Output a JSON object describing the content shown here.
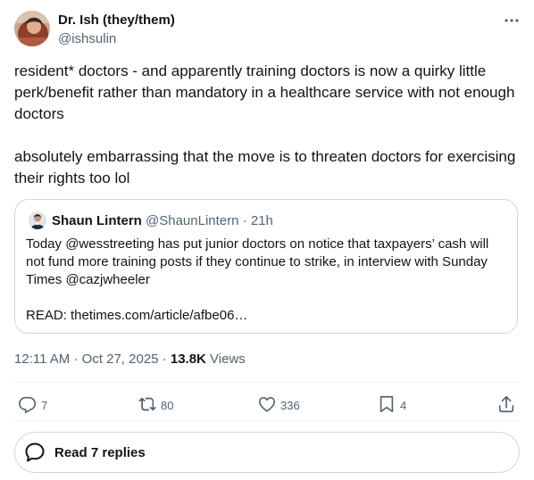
{
  "author": {
    "name": "Dr. Ish (they/them)",
    "handle": "@ishsulin"
  },
  "post": {
    "text": "resident* doctors - and apparently training doctors is now a quirky little perk/benefit rather than mandatory in a healthcare service with not enough doctors\n\nabsolutely embarrassing that the move is to threaten doctors for exercising their rights too lol"
  },
  "quote": {
    "name": "Shaun Lintern",
    "handle": "@ShaunLintern",
    "separator": " · ",
    "age": "21h",
    "text": "Today @wesstreeting has put junior doctors on notice that taxpayers’ cash will not fund more training posts if they continue to strike, in interview with Sunday Times @cazjwheeler\n\nREAD: thetimes.com/article/afbe06…"
  },
  "meta": {
    "time": "12:11 AM",
    "date_sep": " · ",
    "date": "Oct 27, 2025",
    "views_sep": " · ",
    "views_count": "13.8K",
    "views_label": " Views"
  },
  "actions": {
    "replies": "7",
    "reposts": "80",
    "likes": "336",
    "bookmarks": "4"
  },
  "read_replies": {
    "label": "Read 7 replies"
  },
  "icons": {
    "more": "more-horizontal-icon",
    "reply": "reply-bubble-icon",
    "repost": "repost-icon",
    "like": "heart-icon",
    "bookmark": "bookmark-icon",
    "share": "share-icon",
    "read_replies": "speech-bubble-icon"
  },
  "colors": {
    "text_primary": "#0f1419",
    "text_secondary": "#536471",
    "border": "#cfd9de",
    "divider": "#eff3f4"
  }
}
